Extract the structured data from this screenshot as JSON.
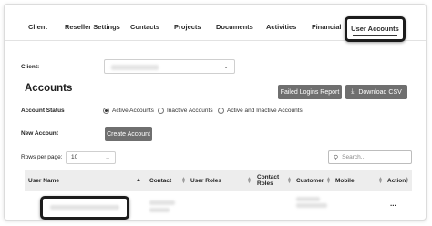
{
  "tabs": [
    "Client",
    "Reseller Settings",
    "Contacts",
    "Projects",
    "Documents",
    "Activities",
    "Financial",
    "User Accounts"
  ],
  "active_tab": "User Accounts",
  "client": {
    "label": "Client:"
  },
  "page_title": "Accounts",
  "buttons": {
    "failed_logins": "Failed Logins Report",
    "download_csv": "Download CSV",
    "create_account": "Create Account"
  },
  "account_status": {
    "label": "Account Status",
    "options": [
      "Active Accounts",
      "Inactive Accounts",
      "Active and Inactive Accounts"
    ],
    "selected": "Active Accounts"
  },
  "new_account_label": "New Account",
  "rows_per_page": {
    "label": "Rows per page:",
    "value": "10"
  },
  "search": {
    "placeholder": "Search..."
  },
  "table": {
    "columns": [
      "User Name",
      "Contact",
      "User Roles",
      "Contact Roles",
      "Customer",
      "Mobile",
      "Action"
    ],
    "row_action": "..."
  },
  "icons": {
    "dropdown": "chevron-down-icon",
    "download": "download-icon",
    "search": "search-icon",
    "sort": "sort-icon"
  }
}
